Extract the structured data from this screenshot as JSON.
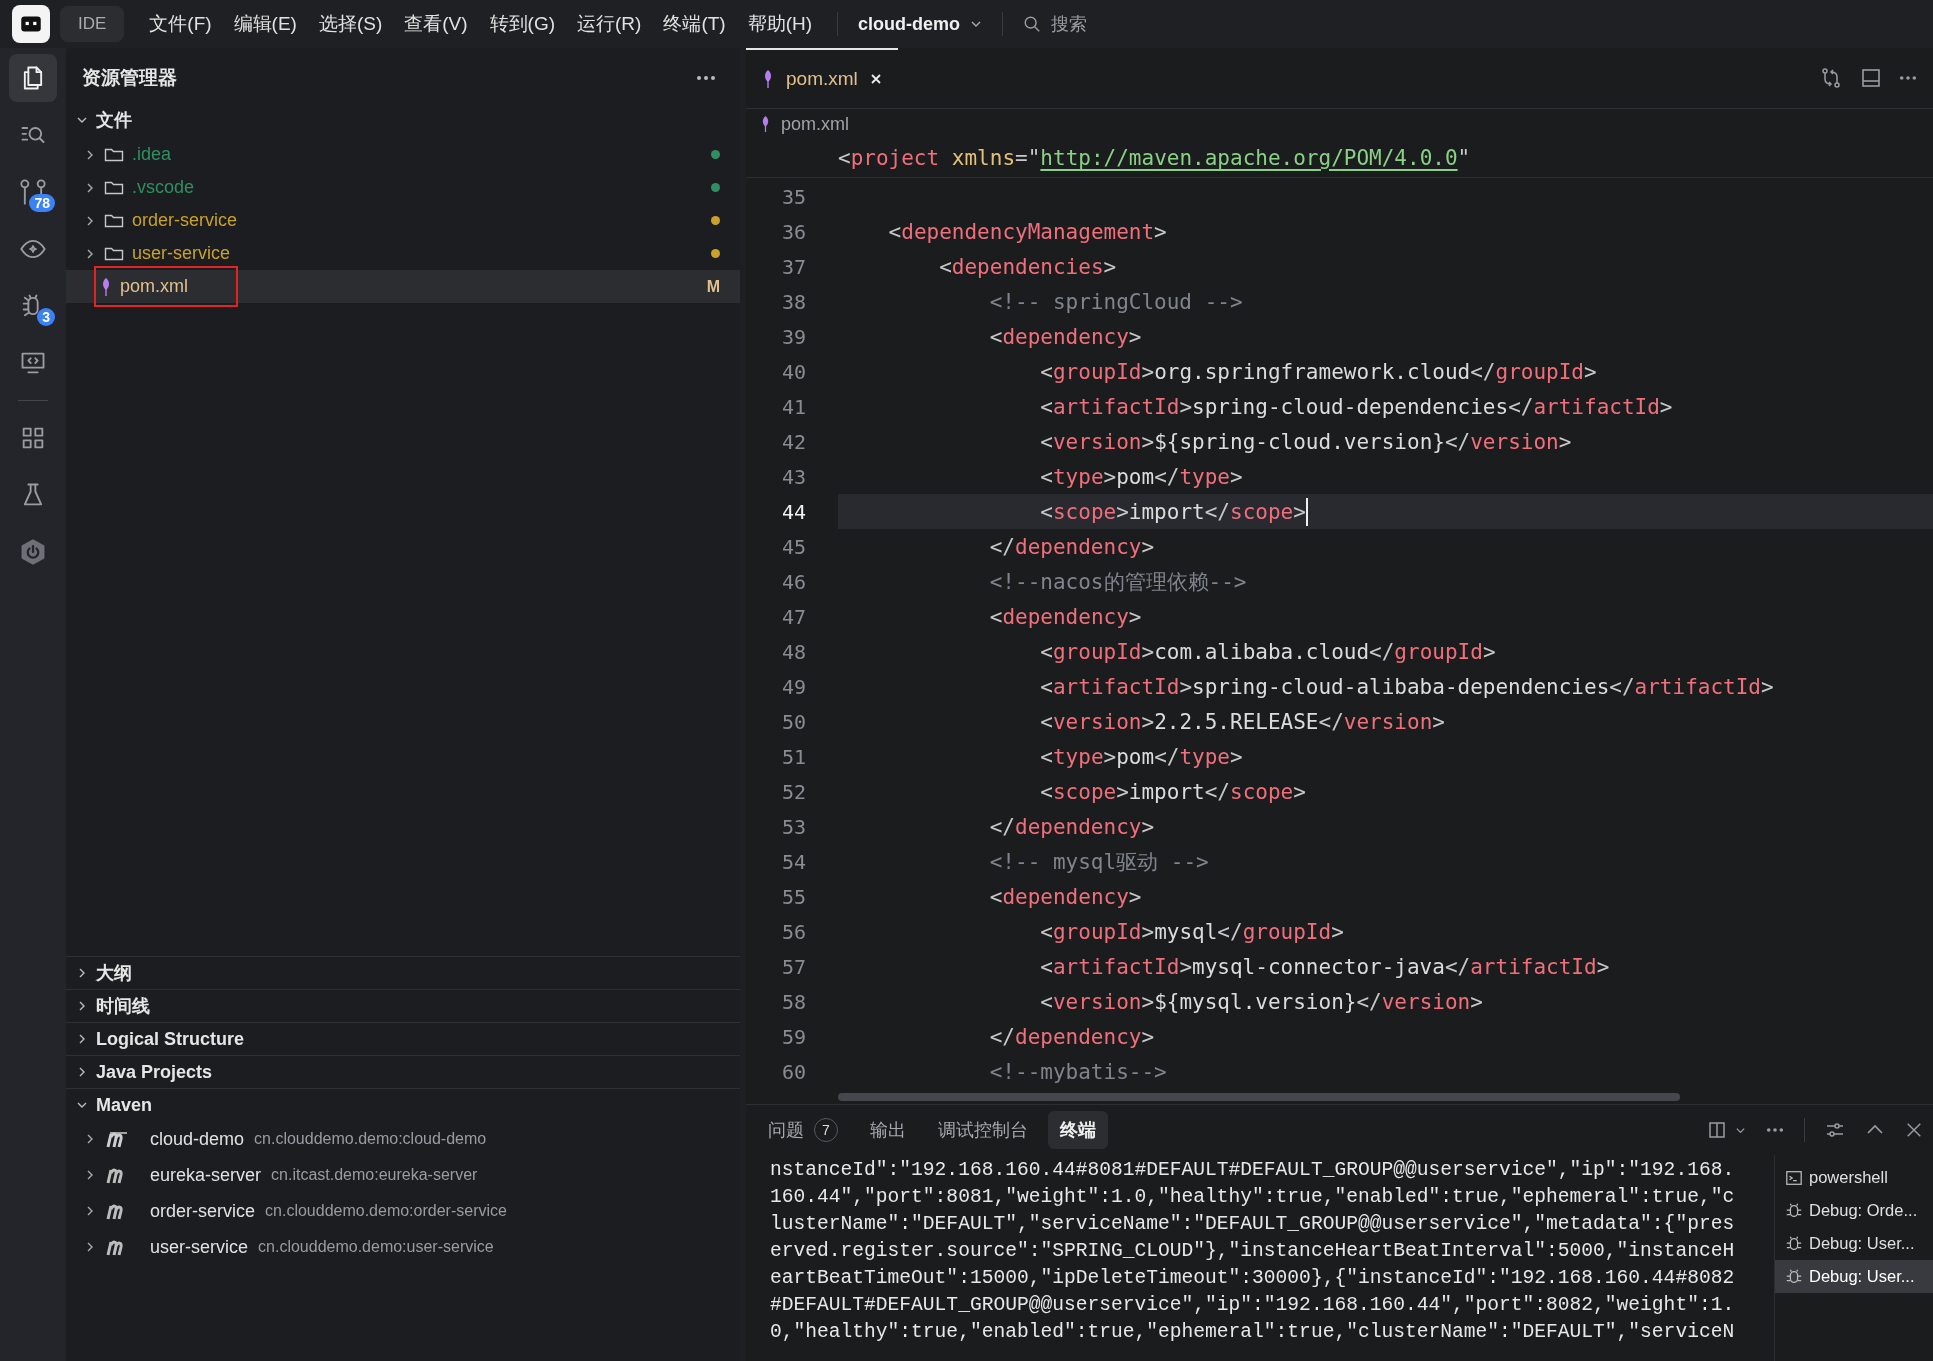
{
  "top_bar": {
    "app_label": "IDE",
    "menus": [
      "文件(F)",
      "编辑(E)",
      "选择(S)",
      "查看(V)",
      "转到(G)",
      "运行(R)",
      "终端(T)",
      "帮助(H)"
    ],
    "project": "cloud-demo",
    "search": {
      "placeholder": "搜索"
    }
  },
  "activity_bar": {
    "top": [
      {
        "kind": "files",
        "selected": true
      },
      {
        "kind": "search",
        "selected": false
      },
      {
        "kind": "source-control",
        "selected": false,
        "badge": "78"
      },
      {
        "kind": "preview",
        "selected": false
      },
      {
        "kind": "debug",
        "selected": false,
        "badge": "3"
      },
      {
        "kind": "remote",
        "selected": false
      }
    ],
    "bottom": [
      {
        "kind": "extensions",
        "selected": false
      },
      {
        "kind": "testing",
        "selected": false
      },
      {
        "kind": "spring",
        "selected": false
      }
    ]
  },
  "sidebar": {
    "title": "资源管理器",
    "folder": {
      "title": "文件",
      "expanded": true,
      "items": [
        {
          "name": ".idea",
          "kind": "folder",
          "color": "#2f8f62",
          "selected": false,
          "annotated": false
        },
        {
          "name": ".vscode",
          "kind": "folder",
          "color": "#2f8f62",
          "selected": false,
          "annotated": false
        },
        {
          "name": "order-service",
          "kind": "folder",
          "color": "#c9a227",
          "selected": false,
          "annotated": false
        },
        {
          "name": "user-service",
          "kind": "folder",
          "color": "#c9a227",
          "selected": false,
          "annotated": false
        },
        {
          "name": "pom.xml",
          "kind": "file",
          "color": "#e2c08d",
          "badge": "M",
          "selected": true,
          "annotated": true
        }
      ]
    },
    "panels": [
      {
        "title": "大纲",
        "expanded": false
      },
      {
        "title": "时间线",
        "expanded": false
      },
      {
        "title": "Logical Structure",
        "expanded": false
      },
      {
        "title": "Java Projects",
        "expanded": false
      },
      {
        "title": "Maven",
        "expanded": true,
        "projects": [
          {
            "name": "cloud-demo",
            "coordinates": "cn.clouddemo.demo:cloud-demo",
            "kind": "parent"
          },
          {
            "name": "eureka-server",
            "coordinates": "cn.itcast.demo:eureka-server",
            "kind": "module"
          },
          {
            "name": "order-service",
            "coordinates": "cn.clouddemo.demo:order-service",
            "kind": "module"
          },
          {
            "name": "user-service",
            "coordinates": "cn.clouddemo.demo:user-service",
            "kind": "module"
          }
        ]
      }
    ]
  },
  "editor": {
    "tabs": [
      {
        "label": "pom.xml",
        "selected": true
      }
    ],
    "breadcrumb": "pom.xml",
    "sticky_line": "<project xmlns=\"http://maven.apache.org/POM/4.0.0\"",
    "lines": [
      {
        "number": "35",
        "current": false
      },
      {
        "number": "36",
        "code": "    <dependencyManagement>",
        "current": false
      },
      {
        "number": "37",
        "code": "        <dependencies>",
        "current": false
      },
      {
        "number": "38",
        "code": "            <!-- springCloud -->",
        "current": false
      },
      {
        "number": "39",
        "code": "            <dependency>",
        "current": false
      },
      {
        "number": "40",
        "code": "                <groupId>org.springframework.cloud</groupId>",
        "current": false
      },
      {
        "number": "41",
        "code": "                <artifactId>spring-cloud-dependencies</artifactId>",
        "current": false
      },
      {
        "number": "42",
        "code": "                <version>${spring-cloud.version}</version>",
        "current": false
      },
      {
        "number": "43",
        "code": "                <type>pom</type>",
        "current": false
      },
      {
        "number": "44",
        "code": "                <scope>import</scope>",
        "current": true
      },
      {
        "number": "45",
        "code": "            </dependency>",
        "current": false
      },
      {
        "number": "46",
        "code": "            <!--nacos的管理依赖-->",
        "current": false
      },
      {
        "number": "47",
        "code": "            <dependency>",
        "current": false
      },
      {
        "number": "48",
        "code": "                <groupId>com.alibaba.cloud</groupId>",
        "current": false
      },
      {
        "number": "49",
        "code": "                <artifactId>spring-cloud-alibaba-dependencies</artifactId>",
        "current": false
      },
      {
        "number": "50",
        "code": "                <version>2.2.5.RELEASE</version>",
        "current": false
      },
      {
        "number": "51",
        "code": "                <type>pom</type>",
        "current": false
      },
      {
        "number": "52",
        "code": "                <scope>import</scope>",
        "current": false
      },
      {
        "number": "53",
        "code": "            </dependency>",
        "current": false
      },
      {
        "number": "54",
        "code": "            <!-- mysql驱动 -->",
        "current": false
      },
      {
        "number": "55",
        "code": "            <dependency>",
        "current": false
      },
      {
        "number": "56",
        "code": "                <groupId>mysql</groupId>",
        "current": false
      },
      {
        "number": "57",
        "code": "                <artifactId>mysql-connector-java</artifactId>",
        "current": false
      },
      {
        "number": "58",
        "code": "                <version>${mysql.version}</version>",
        "current": false
      },
      {
        "number": "59",
        "code": "            </dependency>",
        "current": false
      },
      {
        "number": "60",
        "code": "            <!--mybatis-->",
        "current": false
      }
    ]
  },
  "panel": {
    "tabs": [
      {
        "label": "问题",
        "count": "7",
        "selected": false
      },
      {
        "label": "输出",
        "selected": false
      },
      {
        "label": "调试控制台",
        "selected": false
      },
      {
        "label": "终端",
        "selected": true
      }
    ],
    "terminal_lines": [
      "nstanceId\":\"192.168.160.44#8081#DEFAULT#DEFAULT_GROUP@@userservice\",\"ip\":\"192.168.",
      "160.44\",\"port\":8081,\"weight\":1.0,\"healthy\":true,\"enabled\":true,\"ephemeral\":true,\"c",
      "lusterName\":\"DEFAULT\",\"serviceName\":\"DEFAULT_GROUP@@userservice\",\"metadata\":{\"pres",
      "erved.register.source\":\"SPRING_CLOUD\"},\"instanceHeartBeatInterval\":5000,\"instanceH",
      "eartBeatTimeOut\":15000,\"ipDeleteTimeout\":30000},{\"instanceId\":\"192.168.160.44#8082",
      "#DEFAULT#DEFAULT_GROUP@@userservice\",\"ip\":\"192.168.160.44\",\"port\":8082,\"weight\":1.",
      "0,\"healthy\":true,\"enabled\":true,\"ephemeral\":true,\"clusterName\":\"DEFAULT\",\"serviceN"
    ],
    "terminals": [
      {
        "label": "powershell",
        "kind": "shell",
        "selected": false
      },
      {
        "label": "Debug: Orde...",
        "kind": "debug",
        "selected": false
      },
      {
        "label": "Debug: User...",
        "kind": "debug",
        "selected": false
      },
      {
        "label": "Debug: User...",
        "kind": "debug",
        "selected": true
      }
    ]
  }
}
